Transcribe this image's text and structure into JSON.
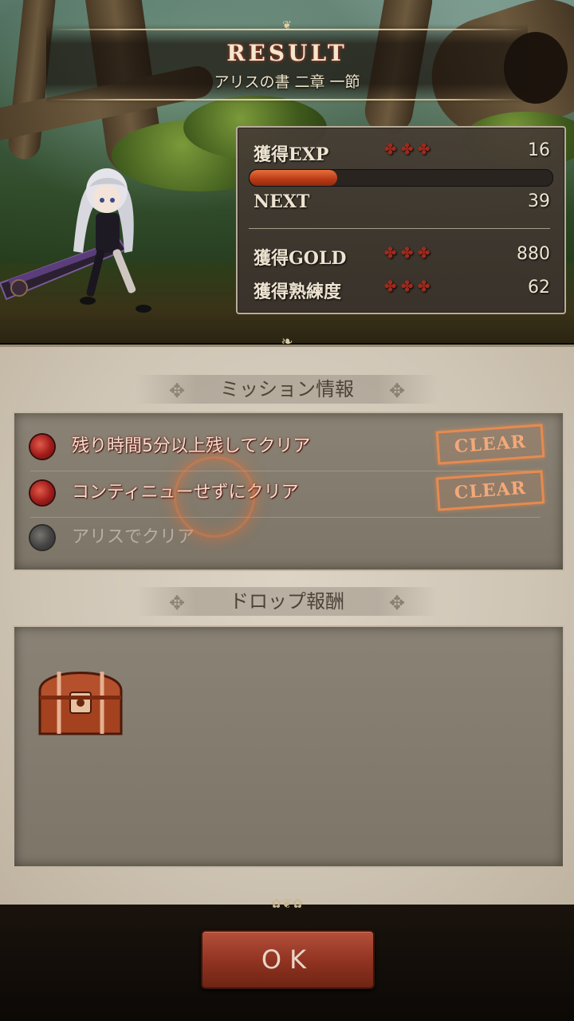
{
  "header": {
    "title": "RESULT",
    "subtitle": "アリスの書 二章 一節"
  },
  "stats": {
    "exp_label": "獲得EXP",
    "exp_value": "16",
    "exp_progress": 0.29,
    "next_label": "NEXT",
    "next_value": "39",
    "gold_label": "獲得GOLD",
    "gold_value": "880",
    "mastery_label": "獲得熟練度",
    "mastery_value": "62",
    "dots": "✤✤✤"
  },
  "missions": {
    "heading": "ミッション情報",
    "items": [
      {
        "text": "残り時間5分以上残してクリア",
        "cleared": true,
        "stamp": "CLEAR"
      },
      {
        "text": "コンティニューせずにクリア",
        "cleared": true,
        "stamp": "CLEAR"
      },
      {
        "text": "アリスでクリア",
        "cleared": false
      }
    ]
  },
  "drops": {
    "heading": "ドロップ報酬",
    "items": [
      {
        "icon": "treasure-chest-icon"
      }
    ]
  },
  "ok_button": {
    "label": "OK"
  },
  "colors": {
    "exp_bar": "#d0562a",
    "clear_stamp": "#e78a4e",
    "ok_button": "#8f3220"
  }
}
